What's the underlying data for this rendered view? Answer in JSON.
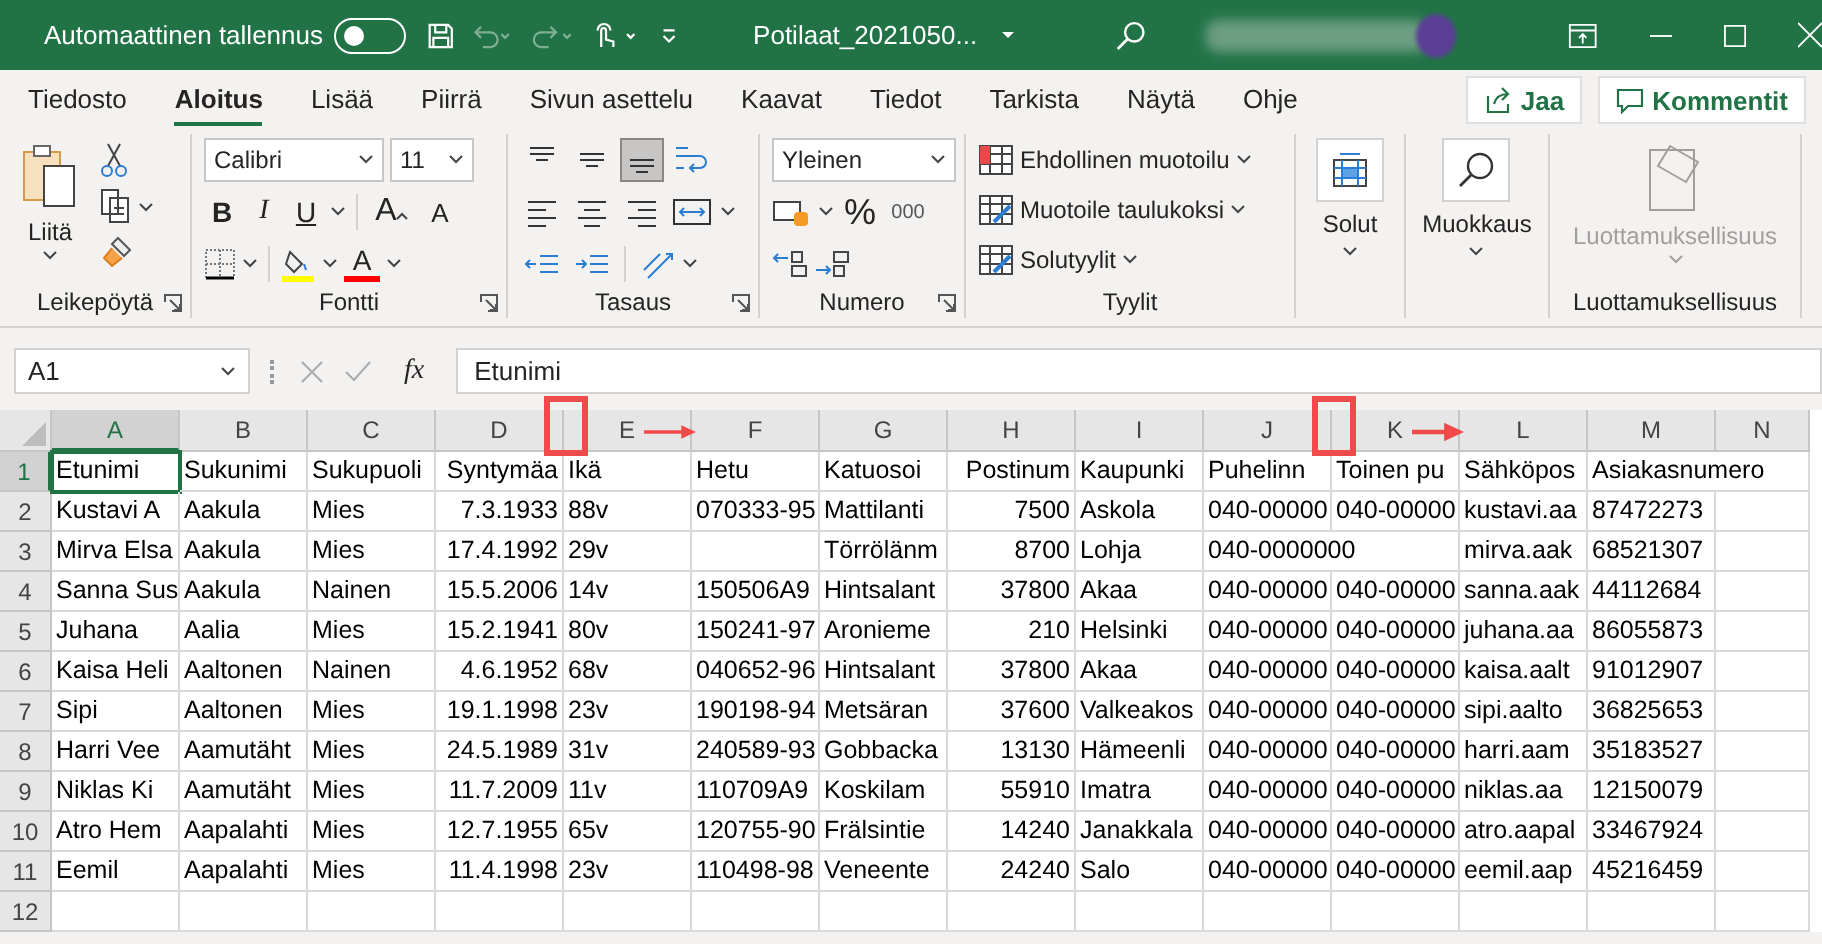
{
  "title_bar": {
    "autosave": {
      "label": "Automaattinen tallennus",
      "on": false
    },
    "quick_access": [
      {
        "kind": "save",
        "disabled": false
      },
      {
        "kind": "undo",
        "disabled": true
      },
      {
        "kind": "redo",
        "disabled": true
      },
      {
        "kind": "touch",
        "disabled": false
      }
    ],
    "file_name": "Potilaat_2021050..."
  },
  "tabs": [
    {
      "label": "Tiedosto",
      "selected": false
    },
    {
      "label": "Aloitus",
      "selected": true
    },
    {
      "label": "Lisää",
      "selected": false
    },
    {
      "label": "Piirrä",
      "selected": false
    },
    {
      "label": "Sivun asettelu",
      "selected": false
    },
    {
      "label": "Kaavat",
      "selected": false
    },
    {
      "label": "Tiedot",
      "selected": false
    },
    {
      "label": "Tarkista",
      "selected": false
    },
    {
      "label": "Näytä",
      "selected": false
    },
    {
      "label": "Ohje",
      "selected": false
    }
  ],
  "share_button": "Jaa",
  "comments_button": "Kommentit",
  "ribbon": {
    "groups": [
      {
        "kind": "clipboard",
        "label": "Leikepöytä",
        "paste": "Liitä"
      },
      {
        "kind": "font",
        "label": "Fontti",
        "font": "Calibri",
        "size": "11",
        "format": [
          {
            "kind": "bold",
            "label": "B"
          },
          {
            "kind": "italic",
            "label": "I"
          },
          {
            "kind": "underline",
            "label": "U"
          }
        ],
        "grow": "A",
        "shrink": "A",
        "font_color": "A"
      },
      {
        "kind": "alignment",
        "label": "Tasaus",
        "align": [
          {
            "kind": "top",
            "selected": false
          },
          {
            "kind": "middle",
            "selected": false
          },
          {
            "kind": "bottom",
            "selected": true
          }
        ]
      },
      {
        "kind": "number",
        "label": "Numero",
        "format": "Yleinen",
        "percent": "%",
        "thousands": "000"
      },
      {
        "kind": "styles",
        "label": "Tyylit",
        "items": [
          "Ehdollinen muotoilu",
          "Muotoile taulukoksi",
          "Solutyylit"
        ]
      },
      {
        "kind": "cells",
        "button": "Solut"
      },
      {
        "kind": "editing",
        "button": "Muokkaus"
      },
      {
        "kind": "sensitivity",
        "label": "Luottamuksellisuus",
        "button": "Luottamuksellisuus",
        "disabled": true
      }
    ]
  },
  "formula_bar": {
    "name_box": "A1",
    "fx": "fx",
    "value": "Etunimi"
  },
  "sheet": {
    "columns": [
      {
        "letter": "A",
        "kind": "text",
        "selected": true
      },
      {
        "letter": "B",
        "kind": "text",
        "selected": false
      },
      {
        "letter": "C",
        "kind": "text",
        "selected": false
      },
      {
        "letter": "D",
        "kind": "number",
        "selected": false
      },
      {
        "letter": "E",
        "kind": "text",
        "selected": false
      },
      {
        "letter": "F",
        "kind": "text",
        "selected": false
      },
      {
        "letter": "G",
        "kind": "text",
        "selected": false
      },
      {
        "letter": "H",
        "kind": "number",
        "selected": false
      },
      {
        "letter": "I",
        "kind": "text",
        "selected": false
      },
      {
        "letter": "J",
        "kind": "text",
        "selected": false
      },
      {
        "letter": "K",
        "kind": "text",
        "selected": false
      },
      {
        "letter": "L",
        "kind": "text",
        "selected": false
      },
      {
        "letter": "M",
        "kind": "text",
        "selected": false
      },
      {
        "letter": "N",
        "kind": "text",
        "selected": false
      }
    ],
    "rows": [
      {
        "number": "1",
        "selected": true,
        "cells": {
          "A": "Etunimi",
          "B": "Sukunimi",
          "C": "Sukupuoli",
          "D": "Syntymäa",
          "E": "Ikä",
          "F": "Hetu",
          "G": "Katuosoi",
          "H": "Postinum",
          "I": "Kaupunki",
          "J": "Puhelinn",
          "K": "Toinen pu",
          "L": "Sähköpos",
          "M": "Asiakasnumero"
        }
      },
      {
        "number": "2",
        "selected": false,
        "cells": {
          "A": "Kustavi A",
          "B": "Aakula",
          "C": "Mies",
          "D": "7.3.1933",
          "E": "88v",
          "F": "070333-95",
          "G": "Mattilanti",
          "H": "7500",
          "I": "Askola",
          "J": "040-00000",
          "K": "040-00000",
          "L": "kustavi.aa",
          "M": "87472273"
        }
      },
      {
        "number": "3",
        "selected": false,
        "cells": {
          "A": "Mirva Elsa",
          "B": "Aakula",
          "C": "Mies",
          "D": "17.4.1992",
          "E": "29v",
          "G": "Törrölänm",
          "H": "8700",
          "I": "Lohja",
          "J": "040-0000000",
          "L": "mirva.aak",
          "M": "68521307"
        }
      },
      {
        "number": "4",
        "selected": false,
        "cells": {
          "A": "Sanna Sus",
          "B": "Aakula",
          "C": "Nainen",
          "D": "15.5.2006",
          "E": "14v",
          "F": "150506A9",
          "G": "Hintsalant",
          "H": "37800",
          "I": "Akaa",
          "J": "040-00000",
          "K": "040-00000",
          "L": "sanna.aak",
          "M": "44112684"
        }
      },
      {
        "number": "5",
        "selected": false,
        "cells": {
          "A": "Juhana",
          "B": "Aalia",
          "C": "Mies",
          "D": "15.2.1941",
          "E": "80v",
          "F": "150241-97",
          "G": "Aronieme",
          "H": "210",
          "I": "Helsinki",
          "J": "040-00000",
          "K": "040-00000",
          "L": "juhana.aa",
          "M": "86055873"
        }
      },
      {
        "number": "6",
        "selected": false,
        "cells": {
          "A": "Kaisa Heli",
          "B": "Aaltonen",
          "C": "Nainen",
          "D": "4.6.1952",
          "E": "68v",
          "F": "040652-96",
          "G": "Hintsalant",
          "H": "37800",
          "I": "Akaa",
          "J": "040-00000",
          "K": "040-00000",
          "L": "kaisa.aalt",
          "M": "91012907"
        }
      },
      {
        "number": "7",
        "selected": false,
        "cells": {
          "A": "Sipi",
          "B": "Aaltonen",
          "C": "Mies",
          "D": "19.1.1998",
          "E": "23v",
          "F": "190198-94",
          "G": "Metsäran",
          "H": "37600",
          "I": "Valkeakos",
          "J": "040-00000",
          "K": "040-00000",
          "L": "sipi.aalto",
          "M": "36825653"
        }
      },
      {
        "number": "8",
        "selected": false,
        "cells": {
          "A": "Harri Vee",
          "B": "Aamutäht",
          "C": "Mies",
          "D": "24.5.1989",
          "E": "31v",
          "F": "240589-93",
          "G": "Gobbacka",
          "H": "13130",
          "I": "Hämeenli",
          "J": "040-00000",
          "K": "040-00000",
          "L": "harri.aam",
          "M": "35183527"
        }
      },
      {
        "number": "9",
        "selected": false,
        "cells": {
          "A": "Niklas Ki",
          "B": "Aamutäht",
          "C": "Mies",
          "D": "11.7.2009",
          "E": "11v",
          "F": "110709A9",
          "G": "Koskilam",
          "H": "55910",
          "I": "Imatra",
          "J": "040-00000",
          "K": "040-00000",
          "L": "niklas.aa",
          "M": "12150079"
        }
      },
      {
        "number": "10",
        "selected": false,
        "cells": {
          "A": "Atro Hem",
          "B": "Aapalahti",
          "C": "Mies",
          "D": "12.7.1955",
          "E": "65v",
          "F": "120755-90",
          "G": "Frälsintie",
          "H": "14240",
          "I": "Janakkala",
          "J": "040-00000",
          "K": "040-00000",
          "L": "atro.aapal",
          "M": "33467924"
        }
      },
      {
        "number": "11",
        "selected": false,
        "cells": {
          "A": "Eemil",
          "B": "Aapalahti",
          "C": "Mies",
          "D": "11.4.1998",
          "E": "23v",
          "F": "110498-98",
          "G": "Veneente",
          "H": "24240",
          "I": "Salo",
          "J": "040-00000",
          "K": "040-00000",
          "L": "eemil.aap",
          "M": "45216459"
        }
      },
      {
        "number": "12",
        "selected": false,
        "cells": {}
      }
    ]
  }
}
